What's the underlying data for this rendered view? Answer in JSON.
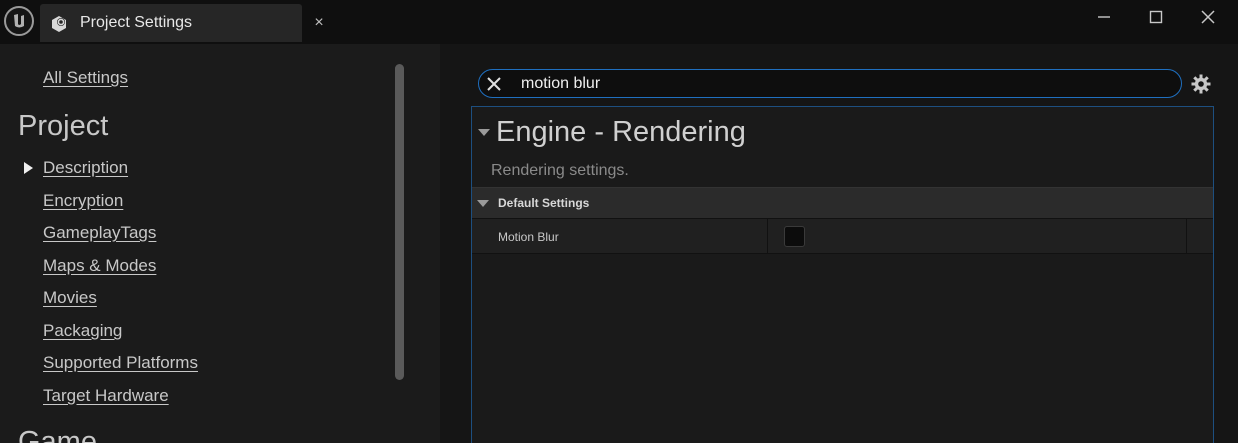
{
  "titlebar": {
    "tab_title": "Project Settings",
    "tab_close_glyph": "×"
  },
  "sidebar": {
    "all_settings": "All Settings",
    "project_heading": "Project",
    "items": [
      {
        "label": "Description",
        "selected": true
      },
      {
        "label": "Encryption"
      },
      {
        "label": "GameplayTags"
      },
      {
        "label": "Maps & Modes"
      },
      {
        "label": "Movies"
      },
      {
        "label": "Packaging"
      },
      {
        "label": "Supported Platforms"
      },
      {
        "label": "Target Hardware"
      }
    ],
    "game_heading": "Game"
  },
  "search": {
    "value": "motion blur"
  },
  "details": {
    "section_title": "Engine - Rendering",
    "section_description": "Rendering settings.",
    "category": "Default Settings",
    "properties": [
      {
        "name": "Motion Blur",
        "checked": false
      }
    ]
  },
  "colors": {
    "accent": "#1f6fbf",
    "background": "#151515",
    "sidebar": "#1b1b1b",
    "category_header": "#2b2b2b"
  },
  "icons": {
    "logo": "unreal-logo-icon",
    "tab": "project-settings-icon",
    "minimize": "minimize-icon",
    "maximize": "maximize-icon",
    "close": "close-icon",
    "search_clear": "clear-icon",
    "settings": "gear-icon"
  }
}
